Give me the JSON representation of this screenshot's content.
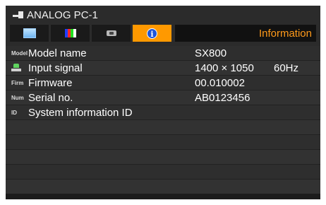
{
  "source": {
    "name": "ANALOG PC-1",
    "icon": "input-connector-icon"
  },
  "tabs": [
    {
      "name": "image-adjustment-tab",
      "icon": "image-adjust-icon",
      "active": false
    },
    {
      "name": "color-adjustment-tab",
      "icon": "color-bars-icon",
      "active": false
    },
    {
      "name": "setup-tab",
      "icon": "setup-icon",
      "active": false
    },
    {
      "name": "information-tab",
      "icon": "info-icon",
      "active": true,
      "glyph": "i"
    }
  ],
  "menu_title": "Information",
  "rows": [
    {
      "icon_text": "Model",
      "label": "Model name",
      "value": "SX800",
      "value2": ""
    },
    {
      "icon_text": "",
      "label": "Input signal",
      "value": "1400 × 1050",
      "value2": "60Hz"
    },
    {
      "icon_text": "Firm",
      "label": "Firmware",
      "value": "00.010002",
      "value2": ""
    },
    {
      "icon_text": "Num",
      "label": "Serial no.",
      "value": "AB0123456",
      "value2": ""
    },
    {
      "icon_text": "ID",
      "label": "System information ID",
      "value": "",
      "value2": ""
    },
    {
      "icon_text": "",
      "label": "",
      "value": "",
      "value2": ""
    },
    {
      "icon_text": "",
      "label": "",
      "value": "",
      "value2": ""
    },
    {
      "icon_text": "",
      "label": "",
      "value": "",
      "value2": ""
    },
    {
      "icon_text": "",
      "label": "",
      "value": "",
      "value2": ""
    },
    {
      "icon_text": "",
      "label": "",
      "value": "",
      "value2": ""
    }
  ],
  "colors": {
    "accent": "#ff9900",
    "title_text": "#ff9a1a",
    "panel": "#2b2b2b"
  }
}
